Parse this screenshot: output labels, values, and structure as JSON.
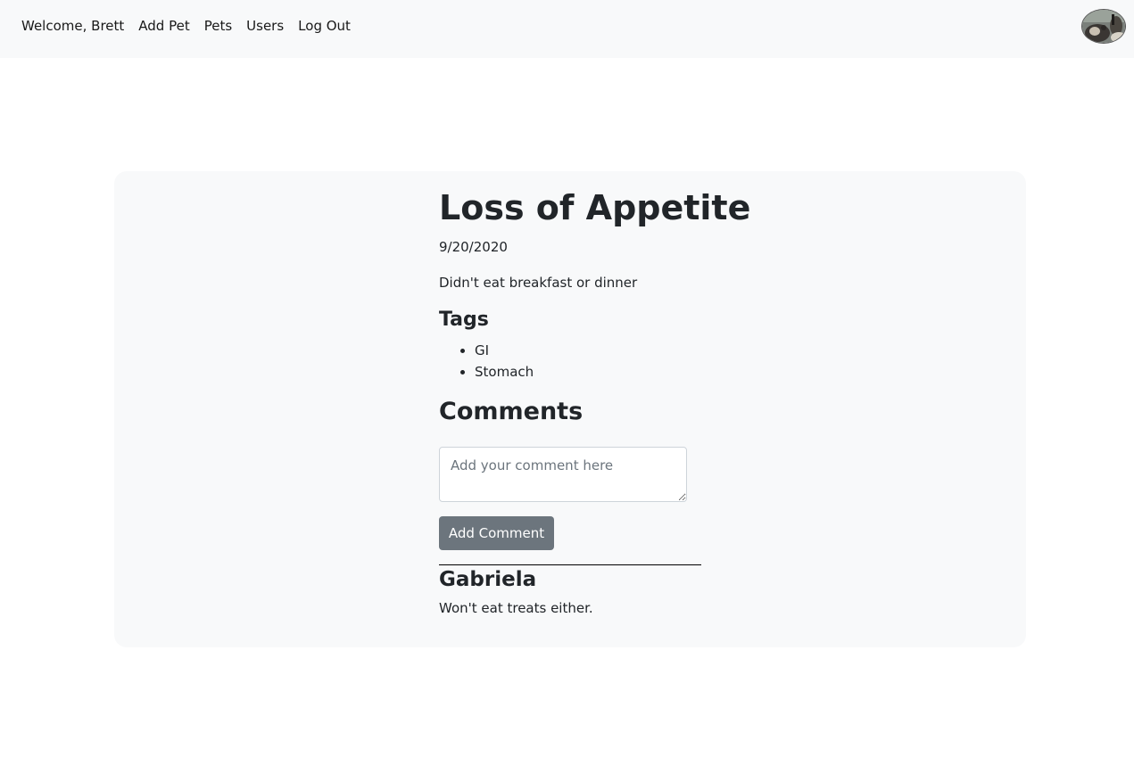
{
  "nav": {
    "welcome": "Welcome, Brett",
    "add_pet": "Add Pet",
    "pets": "Pets",
    "users": "Users",
    "log_out": "Log Out"
  },
  "symptom": {
    "title": "Loss of Appetite",
    "date": "9/20/2020",
    "description": "Didn't eat breakfast or dinner"
  },
  "tags": {
    "heading": "Tags",
    "items": [
      "GI",
      "Stomach"
    ]
  },
  "comments": {
    "heading": "Comments",
    "input_placeholder": "Add your comment here",
    "add_button": "Add Comment",
    "list": [
      {
        "author": "Gabriela",
        "text": "Won't eat treats either."
      }
    ]
  },
  "colors": {
    "navbar_bg": "#f8f9fa",
    "card_bg": "#f8f9fa",
    "button_bg": "#6c757d",
    "text": "#212529"
  }
}
